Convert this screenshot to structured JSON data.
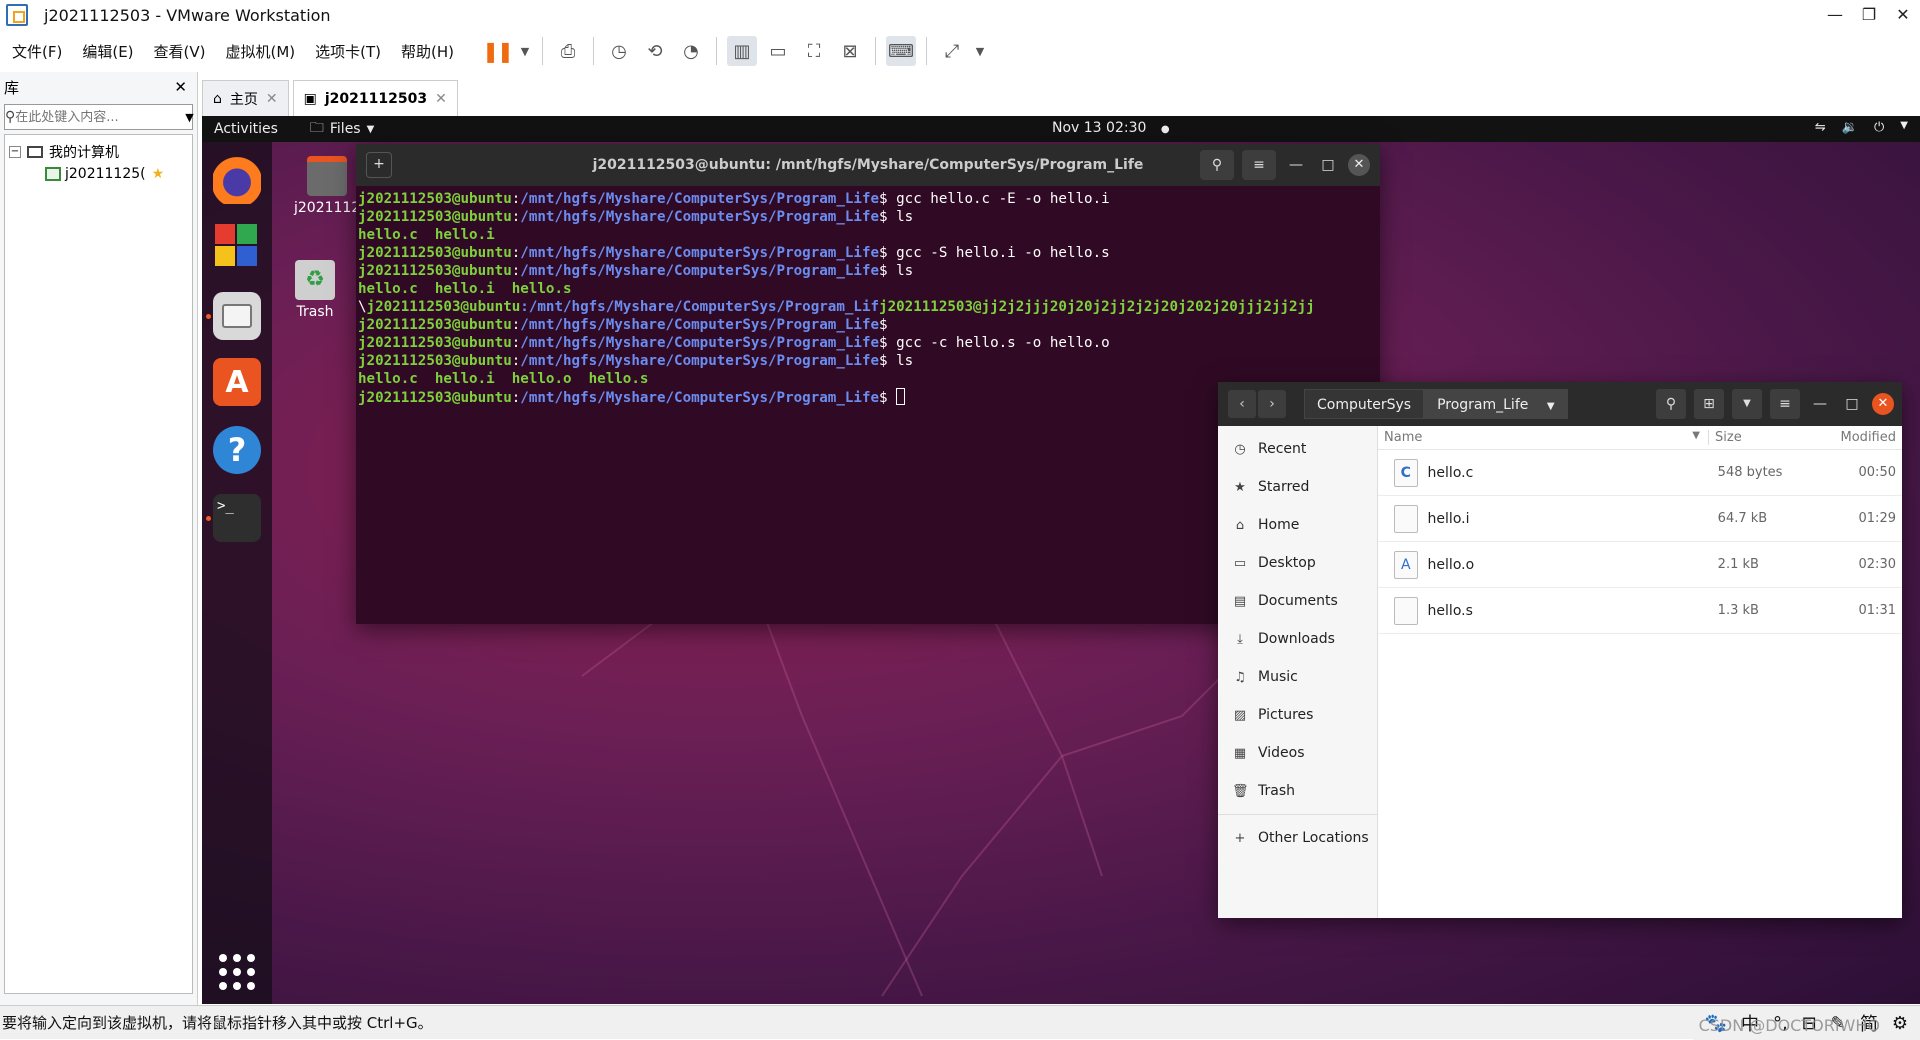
{
  "window": {
    "title": "j2021112503 - VMware Workstation",
    "controls": [
      "—",
      "❐",
      "✕"
    ]
  },
  "menu": [
    "文件(F)",
    "编辑(E)",
    "查看(V)",
    "虚拟机(M)",
    "选项卡(T)",
    "帮助(H)"
  ],
  "library": {
    "title": "库",
    "close": "✕",
    "search_placeholder": "在此处键入内容...",
    "root": "我的计算机",
    "vm": "j20211125("
  },
  "tabs": [
    {
      "label": "主页",
      "active": false
    },
    {
      "label": "j2021112503",
      "active": true
    }
  ],
  "gnome": {
    "activities": "Activities",
    "app_menu": "Files",
    "clock": "Nov 13  02:30",
    "clock_dot": "●"
  },
  "desktop": {
    "home_label": "j2021112",
    "trash_label": "Trash"
  },
  "terminal": {
    "title": "j2021112503@ubuntu: /mnt/hgfs/Myshare/ComputerSys/Program_Life",
    "user": "j2021112503@ubuntu",
    "path": "/mnt/hgfs/Myshare/ComputerSys/Program_Life",
    "lines": [
      {
        "type": "cmd",
        "cmd": " gcc hello.c -E -o hello.i"
      },
      {
        "type": "cmd",
        "cmd": " ls"
      },
      {
        "type": "out",
        "text": "hello.c  hello.i"
      },
      {
        "type": "cmd",
        "cmd": " gcc -S hello.i -o hello.s"
      },
      {
        "type": "cmd",
        "cmd": " ls"
      },
      {
        "type": "out",
        "text": "hello.c  hello.i  hello.s"
      },
      {
        "type": "raw",
        "prefix": "\\",
        "user": "j2021112503@ubuntu",
        "path": ":/mnt/hgfs/Myshare/ComputerSys/Program_Lif",
        "tail": "j2021112503@jj2j2jjj20j20j2jj2j2j20j202j20jjj2jj2jj"
      },
      {
        "type": "cmd",
        "cmd": ""
      },
      {
        "type": "cmd",
        "cmd": " gcc -c hello.s -o hello.o"
      },
      {
        "type": "cmd",
        "cmd": " ls"
      },
      {
        "type": "out",
        "text": "hello.c  hello.i  hello.o  hello.s"
      },
      {
        "type": "prompt",
        "cmd": " "
      }
    ]
  },
  "files": {
    "path": [
      "ComputerSys",
      "Program_Life"
    ],
    "places": [
      {
        "icon": "◷",
        "label": "Recent",
        "name": "recent"
      },
      {
        "icon": "★",
        "label": "Starred",
        "name": "starred"
      },
      {
        "icon": "⌂",
        "label": "Home",
        "name": "home"
      },
      {
        "icon": "▭",
        "label": "Desktop",
        "name": "desktop"
      },
      {
        "icon": "▤",
        "label": "Documents",
        "name": "documents"
      },
      {
        "icon": "⤓",
        "label": "Downloads",
        "name": "downloads"
      },
      {
        "icon": "♫",
        "label": "Music",
        "name": "music"
      },
      {
        "icon": "▨",
        "label": "Pictures",
        "name": "pictures"
      },
      {
        "icon": "▦",
        "label": "Videos",
        "name": "videos"
      },
      {
        "icon": "🗑",
        "label": "Trash",
        "name": "trash"
      }
    ],
    "other_locations": "Other Locations",
    "columns": {
      "name": "Name",
      "size": "Size",
      "modified": "Modified"
    },
    "items": [
      {
        "name": "hello.c",
        "size": "548 bytes",
        "modified": "00:50",
        "glyph": "C",
        "kind": "c"
      },
      {
        "name": "hello.i",
        "size": "64.7 kB",
        "modified": "01:29",
        "glyph": "",
        "kind": "txt"
      },
      {
        "name": "hello.o",
        "size": "2.1 kB",
        "modified": "02:30",
        "glyph": "A",
        "kind": "o"
      },
      {
        "name": "hello.s",
        "size": "1.3 kB",
        "modified": "01:31",
        "glyph": "",
        "kind": "txt"
      }
    ]
  },
  "status": {
    "text": "要将输入定向到该虚拟机，请将鼠标指针移入其中或按 Ctrl+G。",
    "ime": [
      "🐾",
      "中",
      "°,",
      "⊟",
      "✎",
      "简",
      "⚙"
    ],
    "watermark": "CSDN @DOCTORIWHO"
  }
}
